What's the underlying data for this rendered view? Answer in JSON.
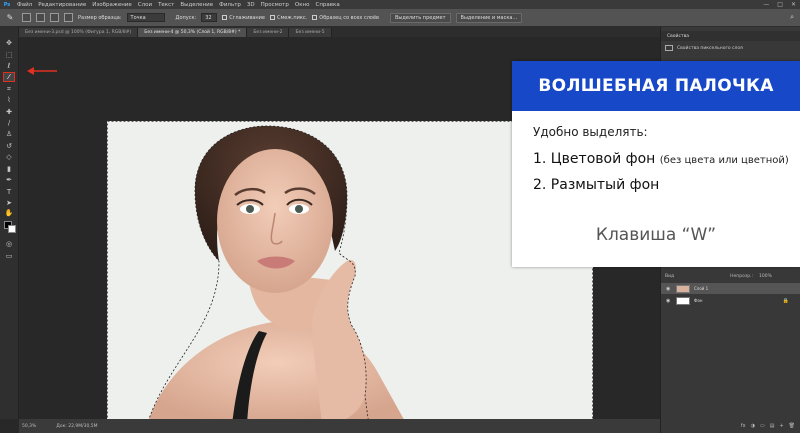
{
  "menubar": {
    "logo": "Ps",
    "items": [
      "Файл",
      "Редактирование",
      "Изображение",
      "Слои",
      "Текст",
      "Выделение",
      "Фильтр",
      "3D",
      "Просмотр",
      "Окно",
      "Справка"
    ],
    "window_controls": [
      "—",
      "□",
      "✕"
    ]
  },
  "options": {
    "sample_size_label": "Размер образца:",
    "sample_size_value": "Точка",
    "tolerance_label": "Допуск:",
    "tolerance_value": "32",
    "antialias_label": "Сглаживание",
    "contiguous_label": "Смеж.пикс.",
    "all_layers_label": "Образец со всех слоёв",
    "select_subject_label": "Выделить предмет",
    "select_mask_label": "Выделение и маска..."
  },
  "tabs": [
    {
      "label": "Без имени-3.psd @ 100% (Фигура 1, RGB/8#)",
      "active": false
    },
    {
      "label": "Без имени-4 @ 50,3% (Слой 1, RGB/8#) *",
      "active": true
    },
    {
      "label": "Без имени-2",
      "active": false
    },
    {
      "label": "Без имени-5",
      "active": false
    }
  ],
  "statusbar": {
    "zoom": "50,3%",
    "doc": "Док: 22,9M/30,5M"
  },
  "panels": {
    "properties_title": "Свойства",
    "properties_row": "Свойства пиксельного слоя",
    "layer_kind": "Вид",
    "opacity_label": "Непрозр.:",
    "opacity_value": "100%",
    "fill_label": "Заливка:",
    "fill_value": "100%",
    "layers": [
      {
        "name": "Слой 1",
        "selected": true
      },
      {
        "name": "Фон",
        "selected": false
      }
    ],
    "layer_icons": [
      "fx",
      "◑",
      "▭",
      "▤",
      "+",
      "🗑"
    ]
  },
  "card": {
    "title": "ВОЛШЕБНАЯ ПАЛОЧКА",
    "intro": "Удобно выделять:",
    "item1_main": "1. Цветовой фон",
    "item1_note": "(без цвета или цветной)",
    "item2": "2. Размытый фон",
    "hotkey": "Клавиша “W”"
  },
  "colors": {
    "accent_blue": "#1748c8",
    "highlight_red": "#e0301e",
    "photo_bg": "#eef0ed"
  }
}
